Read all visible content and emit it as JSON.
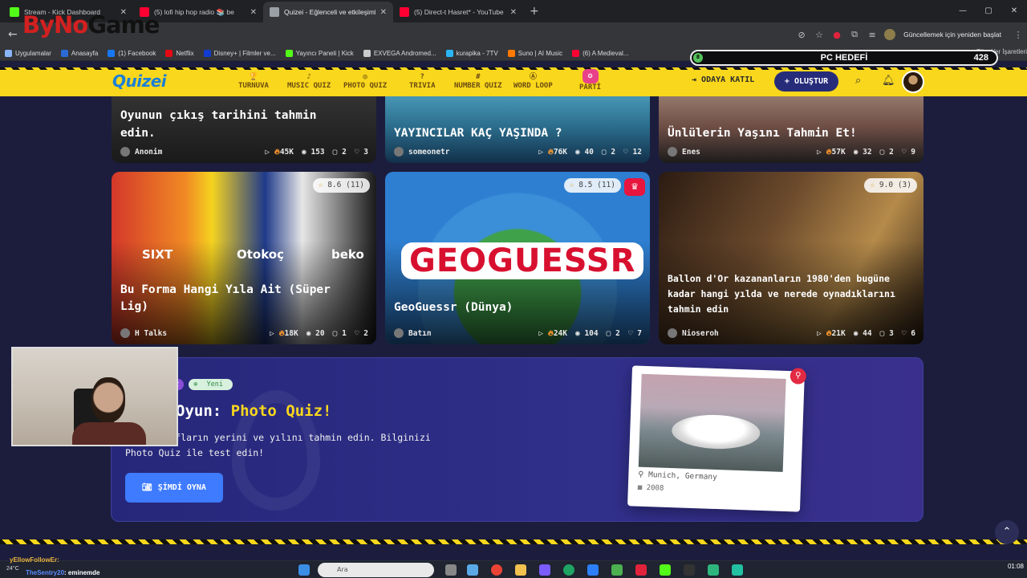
{
  "browser": {
    "tabs": [
      {
        "title": "Stream - Kick Dashboard",
        "color": "#53fc18",
        "active": false
      },
      {
        "title": "(5) lofi hip hop radio 📚 be",
        "color": "#ff0033",
        "active": false
      },
      {
        "title": "Quizei - Eğlenceli ve etkileşimli",
        "color": "#9aa0a6",
        "active": true
      },
      {
        "title": "(5) Direct-t Hasret* - YouTube",
        "color": "#ff0033",
        "active": false
      }
    ],
    "update_label": "Güncellemek için yeniden başlat",
    "overlay_logo": {
      "part1": "ByNo",
      "part2": "Game"
    }
  },
  "bookmarks": [
    {
      "label": "Uygulamalar",
      "color": "#8ab4f8"
    },
    {
      "label": "Anasayfa",
      "color": "#2b6bd6"
    },
    {
      "label": "(1) Facebook",
      "color": "#1877f2"
    },
    {
      "label": "Netflix",
      "color": "#e50914"
    },
    {
      "label": "Disney+ | Filmler ve...",
      "color": "#113ccf"
    },
    {
      "label": "Yayıncı Paneli | Kick",
      "color": "#53fc18"
    },
    {
      "label": "EXVEGA Andromed...",
      "color": "#cccccc"
    },
    {
      "label": "kurapika - 7TV",
      "color": "#29b6f6"
    },
    {
      "label": "Suno | AI Music",
      "color": "#ff7a00"
    },
    {
      "label": "(6) A Medieval...",
      "color": "#ff0033"
    }
  ],
  "bookmarks_right": "Tüm Yer İşaretleri",
  "goal": {
    "label": "PC HEDEFİ",
    "value": "428",
    "badge": "8"
  },
  "site": {
    "brand": "Quizei",
    "nav": [
      {
        "icon": "🏆",
        "label": "TURNUVA"
      },
      {
        "icon": "♪",
        "label": "MUSIC QUIZ"
      },
      {
        "icon": "◎",
        "label": "PHOTO QUIZ"
      },
      {
        "icon": "?",
        "label": "TRIVIA"
      },
      {
        "icon": "#",
        "label": "NUMBER QUIZ"
      },
      {
        "icon": "Ⓐ",
        "label": "WORD LOOP"
      },
      {
        "icon": "✪",
        "label": "PARTİ"
      }
    ],
    "join_label": "ODAYA KATIL",
    "create_label": "+ OLUŞTUR"
  },
  "cards_top": [
    {
      "title_lines": [
        "Oyunun çıkış tarihini tahmin",
        "edin."
      ],
      "author": "Anonim",
      "plays": "45K",
      "views": "153",
      "comments": "2",
      "likes": "3"
    },
    {
      "title_lines": [
        "YAYINCILAR KAÇ YAŞINDA ?"
      ],
      "author": "someonetr",
      "plays": "76K",
      "views": "40",
      "comments": "2",
      "likes": "12"
    },
    {
      "title_lines": [
        "Ünlülerin Yaşını Tahmin Et!"
      ],
      "author": "Enes",
      "plays": "57K",
      "views": "32",
      "comments": "2",
      "likes": "9"
    }
  ],
  "cards": [
    {
      "title_lines": [
        "Bu Forma Hangi Yıla Ait (Süper",
        "Lig)"
      ],
      "author": "H Talks",
      "plays": "18K",
      "views": "20",
      "comments": "1",
      "likes": "2",
      "rating": "8.6",
      "rating_count": "(11)",
      "crown": false,
      "img_text": [
        "SIXT",
        "Otokoç",
        "beko"
      ]
    },
    {
      "title_lines": [
        "GeoGuessr (Dünya)"
      ],
      "author": "Batın",
      "plays": "24K",
      "views": "104",
      "comments": "2",
      "likes": "7",
      "rating": "8.5",
      "rating_count": "(11)",
      "crown": true,
      "img_text": [
        "GEOGUESSR"
      ]
    },
    {
      "title_lines": [
        "Ballon d'Or kazananların 1980'den bugüne",
        "kadar hangi yılda ve nerede oynadıklarını",
        "tahmin edin"
      ],
      "author": "Nioseroh",
      "plays": "21K",
      "views": "44",
      "comments": "3",
      "likes": "6",
      "rating": "9.0",
      "rating_count": "(3)",
      "crown": false,
      "img_text": []
    }
  ],
  "promo": {
    "tag": "iz",
    "new_label": "Yeni",
    "title_prefix": "Oyun:",
    "title_highlight": "Photo Quiz!",
    "desc_lines": [
      "i fotoğrafların yerini ve yılını tahmin edin. Bilginizi",
      "Photo Quiz ile test edin!"
    ],
    "button": "ŞİMDİ OYNA",
    "photo_location": "Munich, Germany",
    "photo_year": "2008"
  },
  "taskbar": {
    "chat": [
      {
        "user": "yEllowFollowEr:",
        "msg": "",
        "color": "#e9b33c"
      },
      {
        "user": "TheSentry20",
        "msg": ": eminemde",
        "color": "#5b8cff"
      }
    ],
    "temp": "24°C",
    "search_placeholder": "Ara",
    "clock": "01:08"
  }
}
